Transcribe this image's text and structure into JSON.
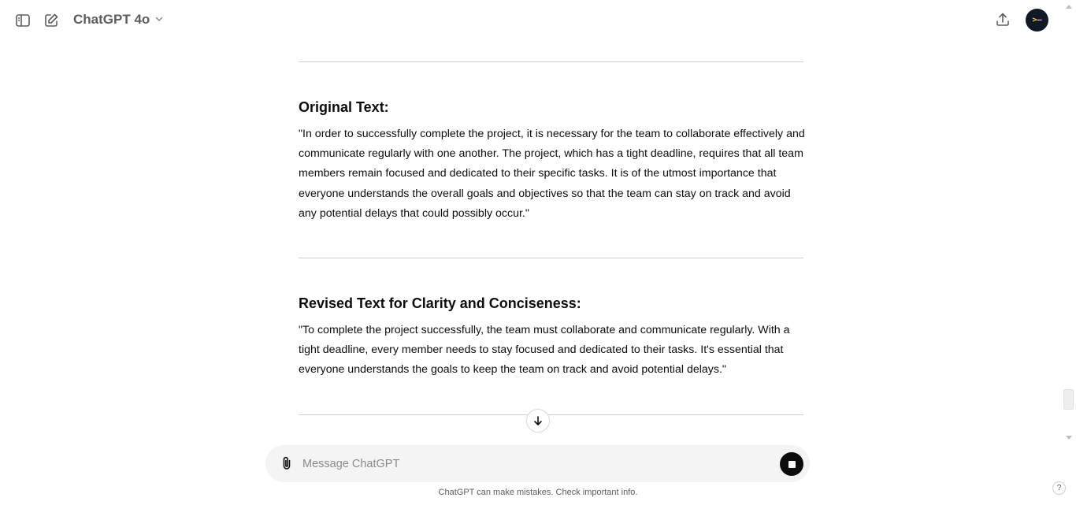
{
  "header": {
    "model_label": "ChatGPT 4o",
    "avatar_text": ">–"
  },
  "message": {
    "sections": [
      {
        "heading": "Original Text:",
        "body": "\"In order to successfully complete the project, it is necessary for the team to collaborate effectively and communicate regularly with one another. The project, which has a tight deadline, requires that all team members remain focused and dedicated to their specific tasks. It is of the utmost importance that everyone understands the overall goals and objectives so that the team can stay on track and avoid any potential delays that could possibly occur.\""
      },
      {
        "heading": "Revised Text for Clarity and Conciseness:",
        "body": "\"To complete the project successfully, the team must collaborate and communicate regularly. With a tight deadline, every member needs to stay focused and dedicated to their tasks. It's essential that everyone understands the goals to keep the team on track and avoid potential delays.\""
      }
    ]
  },
  "composer": {
    "placeholder": "Message ChatGPT"
  },
  "footer": {
    "disclaimer": "ChatGPT can make mistakes. Check important info.",
    "help_label": "?"
  },
  "icons": {
    "sidebar": "sidebar-toggle-icon",
    "new_chat": "compose-icon",
    "share": "share-icon",
    "attach": "paperclip-icon",
    "stop": "stop-icon",
    "scroll_down": "arrow-down-icon"
  }
}
